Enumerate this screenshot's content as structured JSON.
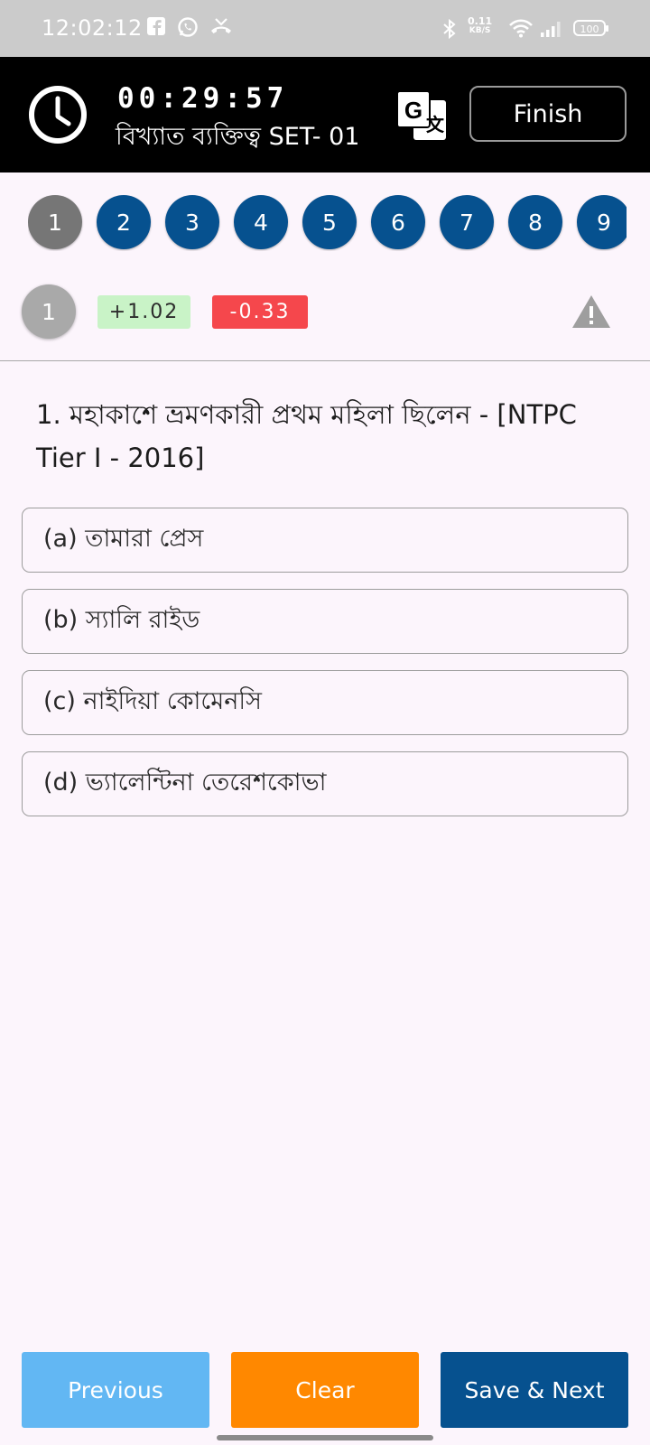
{
  "status_bar": {
    "time": "12:02:12",
    "net_speed_value": "0.11",
    "net_speed_unit": "KB/S",
    "battery": "100",
    "left_icons": [
      "facebook-icon",
      "whatsapp-icon",
      "missed-call-icon"
    ],
    "right_icons": [
      "bluetooth-icon",
      "wifi-icon",
      "signal-icon"
    ]
  },
  "header": {
    "timer": "00:29:57",
    "test_name": "বিখ্যাত ব্যক্তিত্ব SET- 01",
    "finish_label": "Finish",
    "icons": [
      "clock-icon",
      "translate-icon"
    ]
  },
  "palette": {
    "numbers": [
      "1",
      "2",
      "3",
      "4",
      "5",
      "6",
      "7",
      "8",
      "9"
    ],
    "current": "1"
  },
  "info": {
    "question_badge": "1",
    "positive_marks": "+1.02",
    "negative_marks": "-0.33",
    "icon": "report-warning-icon"
  },
  "question": {
    "text": "1. মহাকাশে ভ্রমণকারী প্রথম মহিলা ছিলেন - [NTPC Tier I - 2016]",
    "options": [
      "(a) তামারা প্রেস",
      "(b) স্যালি রাইড",
      "(c) নাইদিয়া কোমেনসি",
      "(d) ভ্যালেন্টিনা তেরেশকোভা"
    ]
  },
  "footer": {
    "previous_label": "Previous",
    "clear_label": "Clear",
    "save_next_label": "Save & Next"
  },
  "colors": {
    "primary": "#06518f",
    "current_question": "#767676",
    "positive_bg": "#c9f3c7",
    "negative_bg": "#f5474c",
    "previous_bg": "#62b7f3",
    "clear_bg": "#ff8800",
    "page_bg": "#fcf5fc"
  }
}
